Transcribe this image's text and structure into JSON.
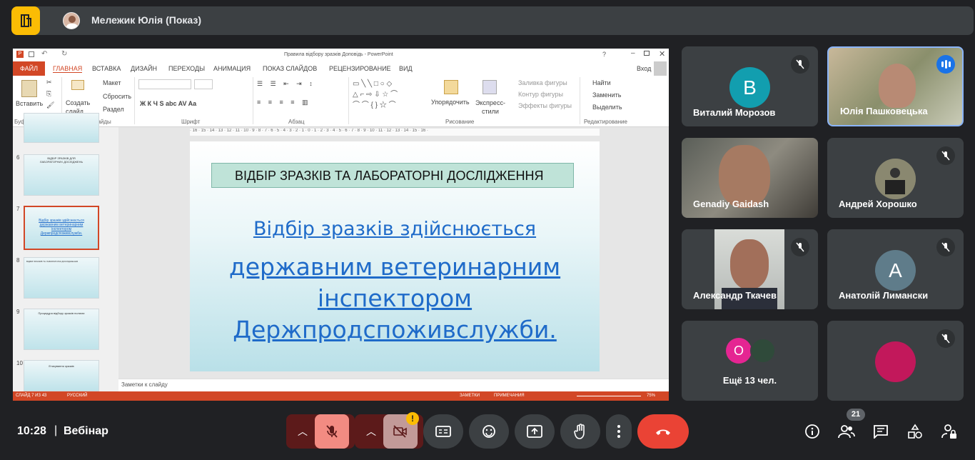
{
  "topbar": {
    "presenter": "Мележик Юлія (Показ)"
  },
  "ppt": {
    "window_title": "Правила відбору зразків Доповідь - PowerPoint",
    "login": "Вход",
    "tabs": [
      "ФАЙЛ",
      "ГЛАВНАЯ",
      "ВСТАВКА",
      "ДИЗАЙН",
      "ПЕРЕХОДЫ",
      "АНИМАЦИЯ",
      "ПОКАЗ СЛАЙДОВ",
      "РЕЦЕНЗИРОВАНИЕ",
      "ВИД"
    ],
    "ribbon": {
      "paste": "Вставить",
      "new_slide": "Создать слайд",
      "layout": "Макет",
      "reset": "Сбросить",
      "section": "Раздел",
      "arrange": "Упорядочить",
      "quick_styles": "Экспресс-стили",
      "shape_fill": "Заливка фигуры",
      "shape_outline": "Контур фигуры",
      "shape_effects": "Эффекты фигуры",
      "find": "Найти",
      "replace": "Заменить",
      "select": "Выделить",
      "groups": {
        "clipboard": "Буфер обмена",
        "slides": "Слайды",
        "font": "Шрифт",
        "paragraph": "Абзац",
        "drawing": "Рисование",
        "editing": "Редактирование"
      },
      "font_buttons": "Ж  К  Ч  S  abc  AV  Aa"
    },
    "thumbnails": [
      {
        "num": "6",
        "text": "ВІДБІР ЗРАЗКІВ ДЛЯ ЛАБОРАТОРНИХ ДОСЛІДЖЕНЬ"
      },
      {
        "num": "7",
        "text": "Відбір зразків здійснюється державним ветеринарним інспектором Держпродспоживслужби."
      },
      {
        "num": "8",
        "text": "ВІДБІР ЗРАЗКІВ ТА ЛАБОРАТОРНІ ДОСЛІДЖЕННЯ"
      },
      {
        "num": "9",
        "text": "Процедура відбору зразків полягає"
      },
      {
        "num": "10",
        "text": "Етикування зразків"
      }
    ],
    "ruler": "· 16 · 15 · 14 · 13 · 12 · 11 · 10 · 9 · 8 · 7 · 6 · 5 · 4 · 3 · 2 · 1 · 0 · 1 · 2 · 3 · 4 · 5 · 6 · 7 · 8 · 9 · 10 · 11 · 12 · 13 · 14 · 15 · 16 ·",
    "slide": {
      "heading": "ВІДБІР ЗРАЗКІВ ТА ЛАБОРАТОРНІ ДОСЛІДЖЕННЯ",
      "line1": "Відбір зразків здійснюється",
      "line2": "державним  ветеринарним",
      "line3": "інспектором",
      "line4": "Держпродспоживслужби."
    },
    "notes": "Заметки к слайду",
    "status": {
      "slide": "СЛАЙД 7 ИЗ 43",
      "lang": "РУССКИЙ",
      "notes": "ЗАМЕТКИ",
      "comments": "ПРИМЕЧАНИЯ",
      "zoom": "75%"
    }
  },
  "participants": [
    {
      "name": "Виталий Морозов",
      "initial": "B",
      "color": "#129eaf"
    },
    {
      "name": "Юлія Пашковецька"
    },
    {
      "name": "Genadiy Gaidash"
    },
    {
      "name": "Андрей Хорошко"
    },
    {
      "name": "Александр Ткачев"
    },
    {
      "name": "Анатолій Лимански",
      "initial": "A",
      "color": "#5f7c8a"
    },
    {
      "name": "Ещё 13 чел.",
      "initial": "О",
      "color": "#e52592"
    }
  ],
  "bottom": {
    "time": "10:28",
    "separator": "|",
    "meeting": "Вебінар",
    "people_count": "21"
  }
}
